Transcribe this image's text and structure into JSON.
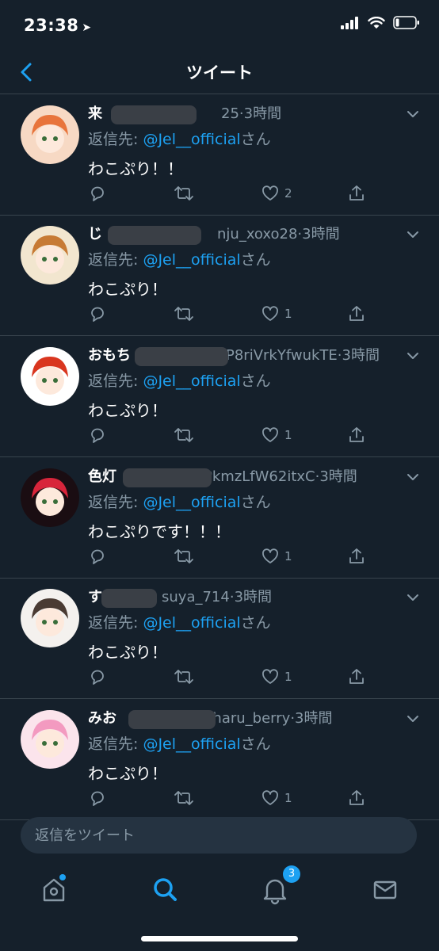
{
  "status": {
    "time": "23:38"
  },
  "nav": {
    "title": "ツイート"
  },
  "tweets": [
    {
      "name": "来",
      "handle_tail": "25",
      "time_sep": "·",
      "time": "3時間",
      "reply_prefix": "返信先: ",
      "mention": "@Jel__official",
      "reply_suffix": "さん",
      "text": "わこぷり！！",
      "likes": "2",
      "avatar_color": "#f7d9c4",
      "avatar_hair": "#e8743b"
    },
    {
      "name": "じ",
      "handle_tail": "nju_xoxo28",
      "time_sep": "·",
      "time": "3時間",
      "reply_prefix": "返信先: ",
      "mention": "@Jel__official",
      "reply_suffix": "さん",
      "text": "わこぷり！",
      "likes": "1",
      "avatar_color": "#f2e6cf",
      "avatar_hair": "#c77a34"
    },
    {
      "name": "おもち",
      "handle_tail": "P8riVrkYfwukTE",
      "time_sep": "·",
      "time": "3時間",
      "reply_prefix": "返信先: ",
      "mention": "@Jel__official",
      "reply_suffix": "さん",
      "text": "わこぷり！",
      "likes": "1",
      "avatar_color": "#ffffff",
      "avatar_hair": "#d9361f"
    },
    {
      "name": "色灯",
      "handle_tail": "PkmzLfW62itxC",
      "time_sep": "·",
      "time": "3時間",
      "reply_prefix": "返信先: ",
      "mention": "@Jel__official",
      "reply_suffix": "さん",
      "text": "わこぷりです！！！",
      "likes": "1",
      "avatar_color": "#1a0d12",
      "avatar_hair": "#d8253b"
    },
    {
      "name": "す",
      "handle_tail": "suya_714",
      "time_sep": "·",
      "time": "3時間",
      "reply_prefix": "返信先: ",
      "mention": "@Jel__official",
      "reply_suffix": "さん",
      "text": "わこぷり！",
      "likes": "1",
      "avatar_color": "#f4f1ee",
      "avatar_hair": "#4a3b33"
    },
    {
      "name": "みお",
      "handle_tail": "pharu_berry",
      "time_sep": "·",
      "time": "3時間",
      "reply_prefix": "返信先: ",
      "mention": "@Jel__official",
      "reply_suffix": "さん",
      "text": "わこぷり！",
      "likes": "1",
      "avatar_color": "#fbe4ec",
      "avatar_hair": "#f39ac0"
    }
  ],
  "compose": {
    "placeholder": "返信をツイート"
  },
  "tabbar": {
    "notification_count": "3"
  },
  "colors": {
    "accent": "#1da1f2",
    "background": "#15202b",
    "muted": "#8899a6",
    "divider": "#38444d"
  }
}
